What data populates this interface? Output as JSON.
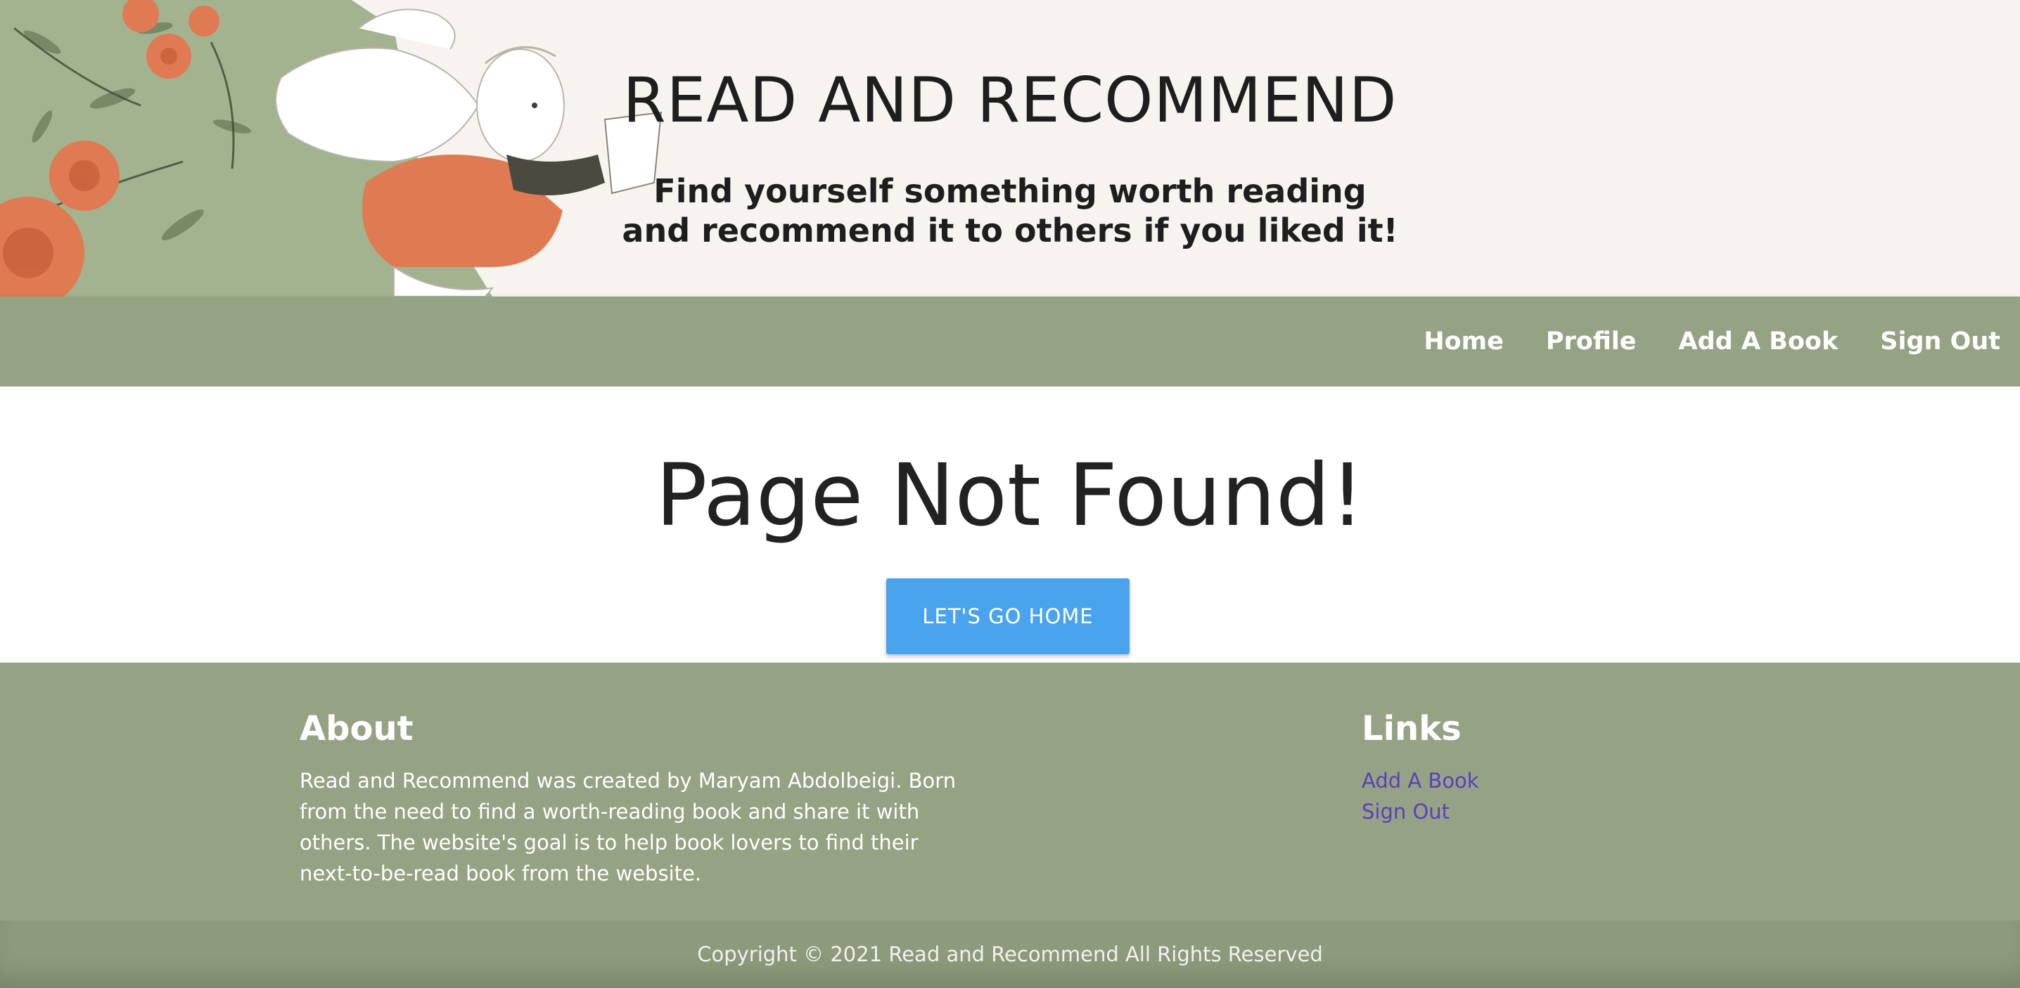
{
  "header": {
    "title": "READ AND RECOMMEND",
    "subtitle_line1": "Find yourself something worth reading",
    "subtitle_line2": "and recommend it to others if you liked it!"
  },
  "nav": {
    "items": [
      {
        "label": "Home"
      },
      {
        "label": "Profile"
      },
      {
        "label": "Add A Book"
      },
      {
        "label": "Sign Out"
      }
    ]
  },
  "main": {
    "heading": "Page Not Found!",
    "button_label": "LET'S GO HOME"
  },
  "footer": {
    "about": {
      "heading": "About",
      "text": "Read and Recommend was created by Maryam Abdolbeigi. Born from the need to find a worth-reading book and share it with others. The website's goal is to help book lovers to find their next-to-be-read book from the website."
    },
    "links": {
      "heading": "Links",
      "items": [
        {
          "label": "Add A Book"
        },
        {
          "label": "Sign Out"
        }
      ]
    },
    "copyright": "Copyright © 2021 Read and Recommend All Rights Reserved"
  },
  "colors": {
    "header_bg": "#f7f4ef",
    "nav_bg": "#95a283",
    "button_bg": "#4aa3ed",
    "footer_link": "#5a3fc0",
    "illustration_orange": "#e07a52",
    "illustration_green": "#a3b28f"
  }
}
